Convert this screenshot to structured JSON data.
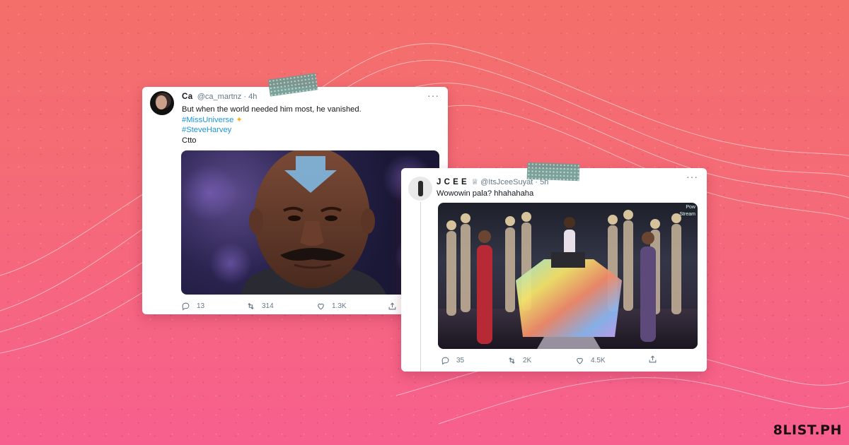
{
  "brand": "8LIST.PH",
  "tweets": [
    {
      "name": "Ca",
      "handle": "@ca_martnz",
      "time": "· 4h",
      "text": "But when the world needed him most, he vanished.",
      "hashtags": [
        "#MissUniverse",
        "#SteveHarvey"
      ],
      "sparkle": "✦",
      "extra": "Ctto",
      "more": "···",
      "replies": "13",
      "retweets": "314",
      "likes": "1.3K"
    },
    {
      "name": "J C E E",
      "crown": "♕",
      "handle": "@ItsJceeSuyat",
      "time": "· 5h",
      "text": "Wowowin pala? hhahahaha",
      "more": "···",
      "replies": "35",
      "retweets": "2K",
      "likes": "4.5K",
      "overlay_labels": [
        "Pow",
        "Stream"
      ]
    }
  ],
  "colors": {
    "background_top": "#f46f6a",
    "background_bottom": "#f75f8e",
    "hashtag": "#1b95e0",
    "tape": "#6f9a92"
  }
}
